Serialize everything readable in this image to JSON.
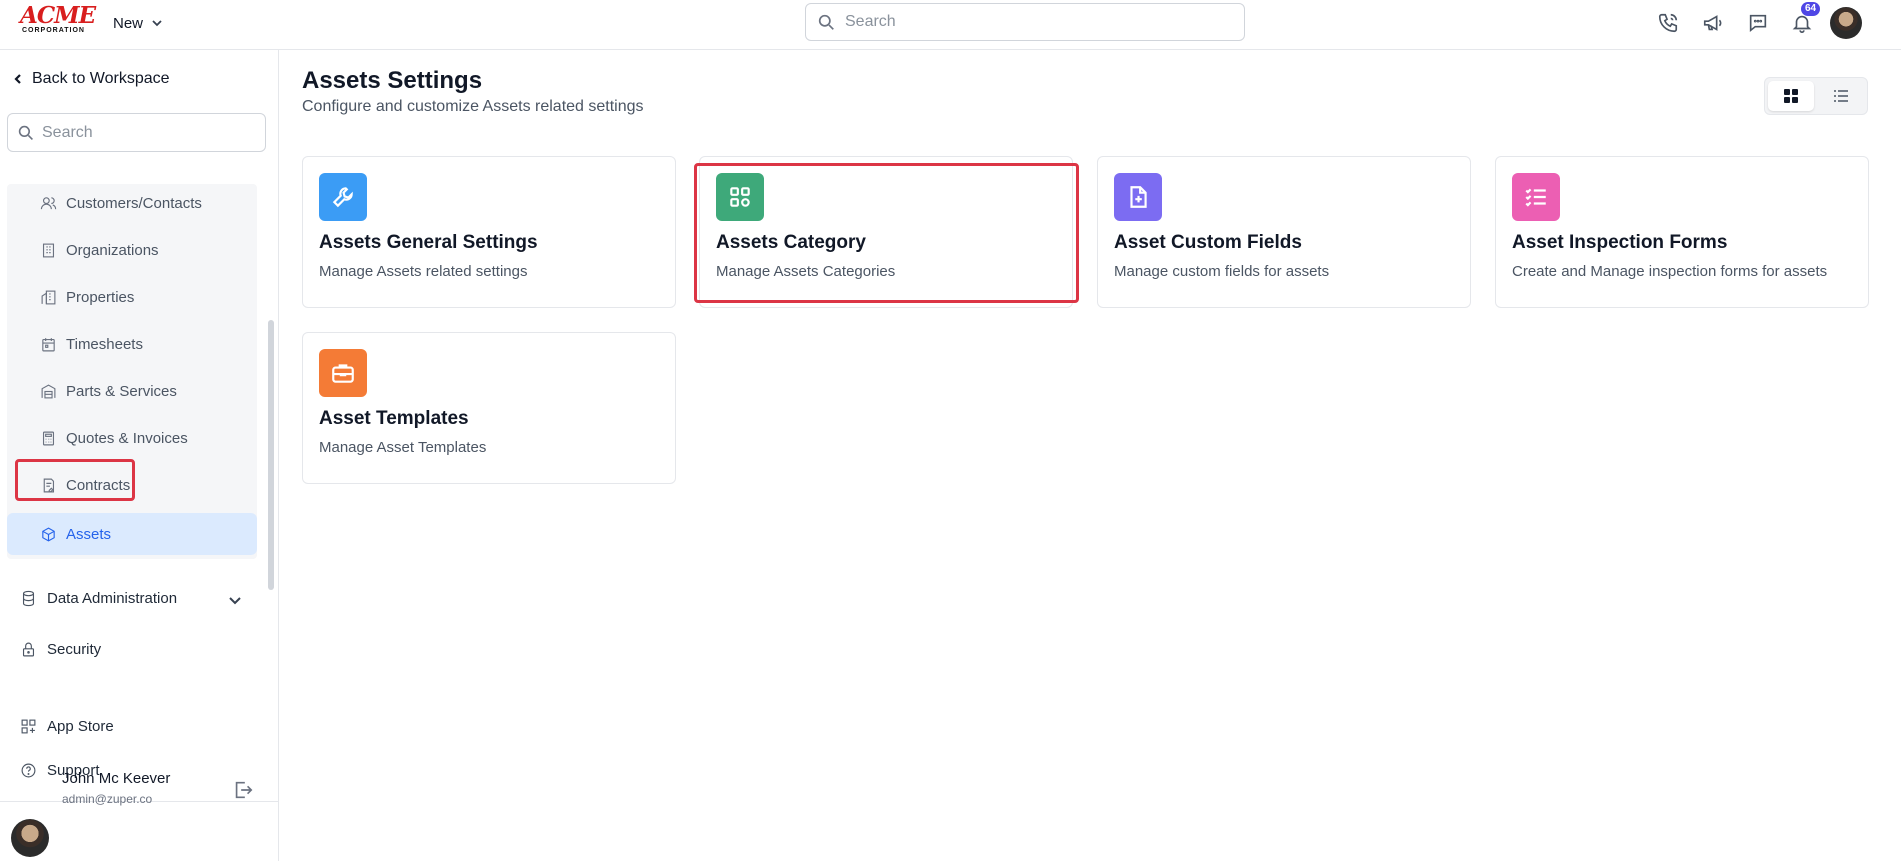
{
  "app": {
    "logo_text": "ACME",
    "logo_sub": "CORPORATION",
    "new_label": "New",
    "search_placeholder": "Search",
    "notification_count": "64"
  },
  "sidebar": {
    "back_label": "Back to Workspace",
    "search_placeholder": "Search",
    "items": [
      {
        "label": "Customers/Contacts",
        "icon": "users-icon"
      },
      {
        "label": "Organizations",
        "icon": "building-icon"
      },
      {
        "label": "Properties",
        "icon": "property-icon"
      },
      {
        "label": "Timesheets",
        "icon": "calendar-icon"
      },
      {
        "label": "Parts & Services",
        "icon": "warehouse-icon"
      },
      {
        "label": "Quotes & Invoices",
        "icon": "calculator-icon"
      },
      {
        "label": "Contracts",
        "icon": "contract-icon"
      },
      {
        "label": "Assets",
        "icon": "cube-icon",
        "active": true
      }
    ],
    "sections": {
      "data_admin": "Data Administration",
      "security": "Security",
      "app_store": "App Store",
      "support": "Support"
    },
    "user": {
      "name": "John Mc Keever",
      "email": "admin@zuper.co"
    }
  },
  "main": {
    "title": "Assets Settings",
    "subtitle": "Configure and customize Assets related settings",
    "cards": [
      {
        "title": "Assets General Settings",
        "description": "Manage Assets related settings",
        "icon": "wrench-icon",
        "color": "#3b9cf5"
      },
      {
        "title": "Assets Category",
        "description": "Manage Assets Categories",
        "icon": "grid-icon",
        "color": "#3ea97a"
      },
      {
        "title": "Asset Custom Fields",
        "description": "Manage custom fields for assets",
        "icon": "file-plus-icon",
        "color": "#7c6cf2"
      },
      {
        "title": "Asset Inspection Forms",
        "description": "Create and Manage inspection forms for assets",
        "icon": "checklist-icon",
        "color": "#ec5fb3"
      },
      {
        "title": "Asset Templates",
        "description": "Manage Asset Templates",
        "icon": "briefcase-icon",
        "color": "#f47b36"
      }
    ]
  },
  "colors": {
    "highlight": "#dc3545",
    "active_bg": "#dbeafe",
    "active_text": "#2563eb"
  }
}
